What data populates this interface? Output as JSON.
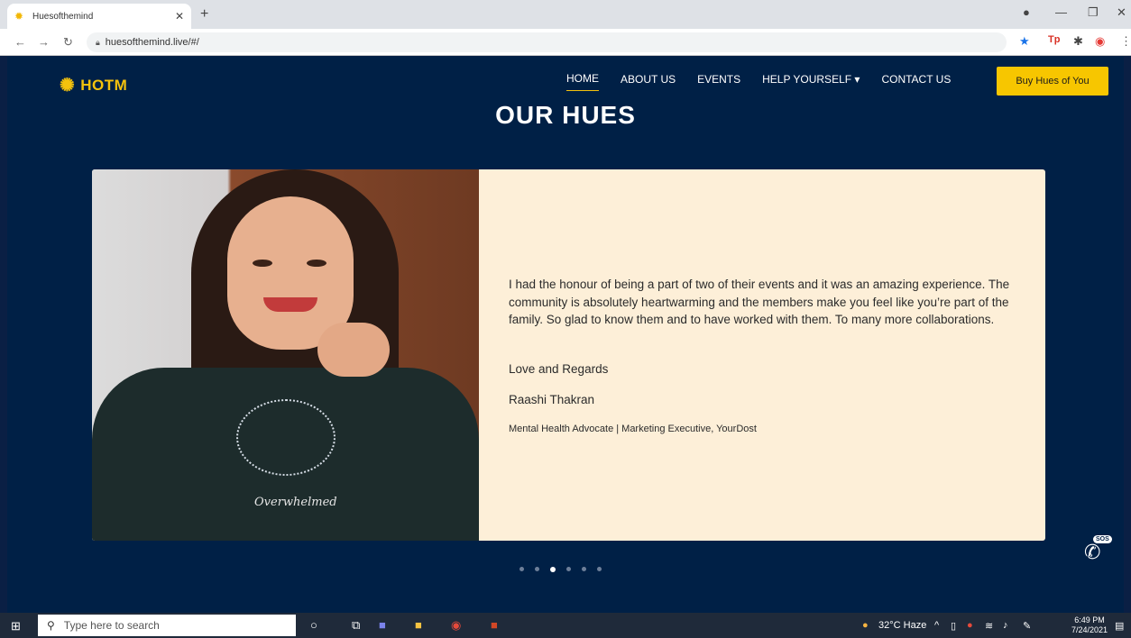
{
  "browser": {
    "tab_title": "Huesofthemind",
    "url": "huesofthemind.live/#/"
  },
  "site": {
    "logo_text": "HOTM",
    "nav": [
      {
        "label": "HOME",
        "active": true
      },
      {
        "label": "ABOUT US"
      },
      {
        "label": "EVENTS"
      },
      {
        "label": "HELP YOURSELF ▾"
      },
      {
        "label": "CONTACT US"
      }
    ],
    "cta_label": "Buy Hues of You",
    "heading": "OUR HUES",
    "testimonial": {
      "photo_text": "Overwhelmed",
      "quote": "I had the honour of being a part of two of their events and it was an amazing experience. The community is absolutely heartwarming and the members make you feel like you’re part of the family. So glad to know them and to have worked with them. To many more collaborations.",
      "regards": "Love and Regards",
      "author": "Raashi Thakran",
      "role": "Mental Health Advocate | Marketing Executive, YourDost"
    },
    "carousel": {
      "count": 6,
      "active_index": 2
    },
    "sos_label": "SOS"
  },
  "taskbar": {
    "search_placeholder": "Type here to search",
    "weather": "32°C Haze",
    "time": "6:49 PM",
    "date": "7/24/2021"
  },
  "colors": {
    "site_bg": "#002046",
    "accent": "#f7c600",
    "card_bg": "#fdefd8"
  }
}
